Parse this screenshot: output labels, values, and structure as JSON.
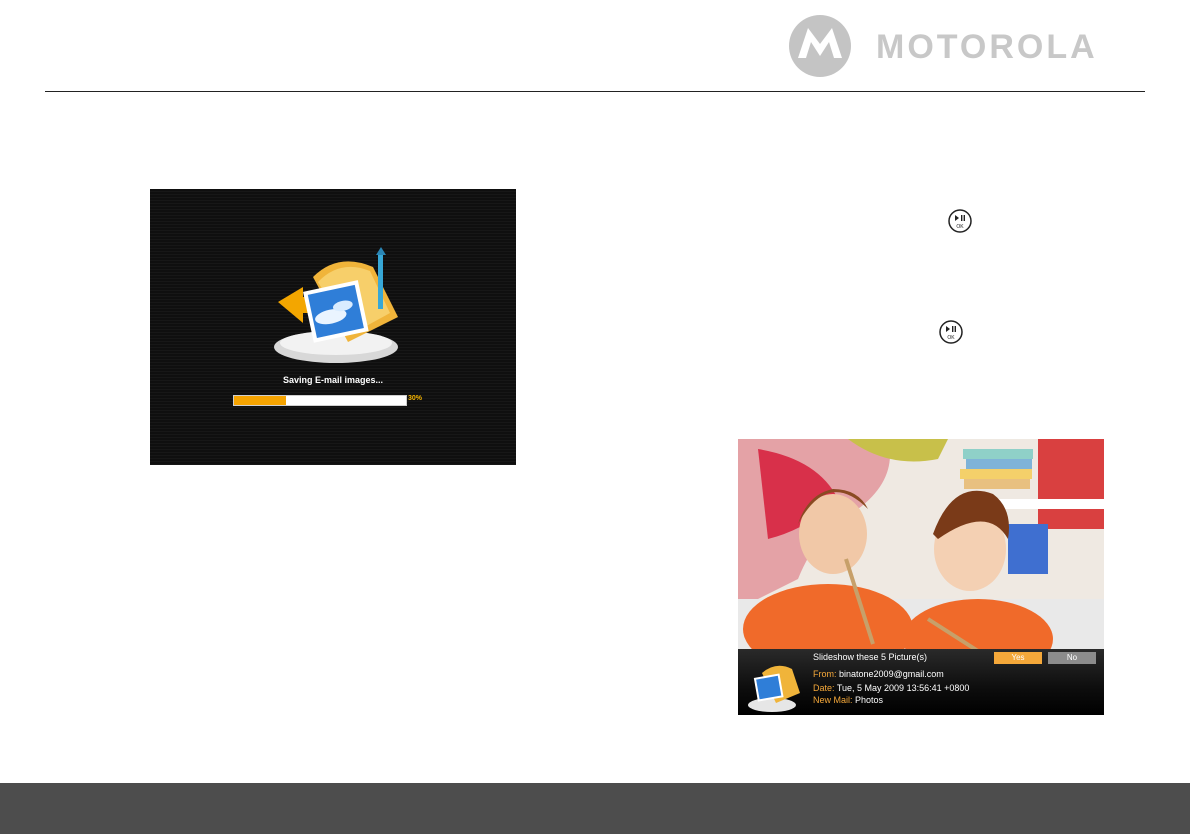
{
  "brand": {
    "name": "MOTOROLA"
  },
  "colors": {
    "accent": "#f5a300",
    "footer": "#4d4d4d",
    "logo_gray": "#c8c8c8"
  },
  "saving_screen": {
    "message": "Saving E-mail images...",
    "progress_label": "30%",
    "progress": 0.3
  },
  "ok_button_icon": "play-pause-ok-icon",
  "mail_screen": {
    "prompt": "Slideshow these 5 Picture(s)",
    "yes_label": "Yes",
    "no_label": "No",
    "from_label": "From:",
    "from_value": "binatone2009@gmail.com",
    "date_label": "Date:",
    "date_value": "Tue, 5 May 2009 13:56:41 +0800",
    "newmail_label": "New Mail:",
    "newmail_value": "Photos"
  }
}
